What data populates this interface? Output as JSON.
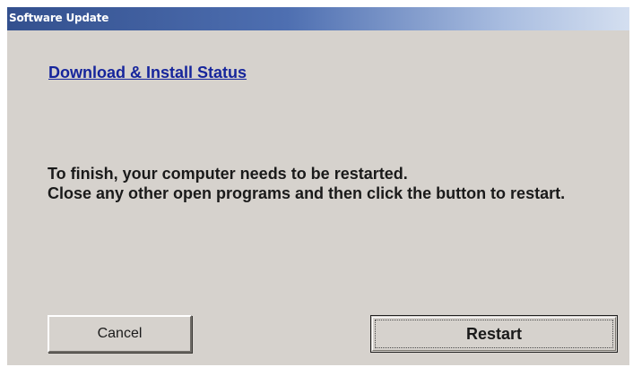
{
  "window": {
    "title": "Software Update"
  },
  "content": {
    "status_link": "Download & Install Status",
    "message_line1": "To finish, your computer needs to be restarted.",
    "message_line2": "Close any other open programs and then click the button to restart."
  },
  "buttons": {
    "cancel_label": "Cancel",
    "restart_label": "Restart"
  },
  "colors": {
    "titlebar_start": "#33508e",
    "titlebar_end": "#d4dff0",
    "window_background": "#d6d2cd",
    "link": "#16259c"
  }
}
